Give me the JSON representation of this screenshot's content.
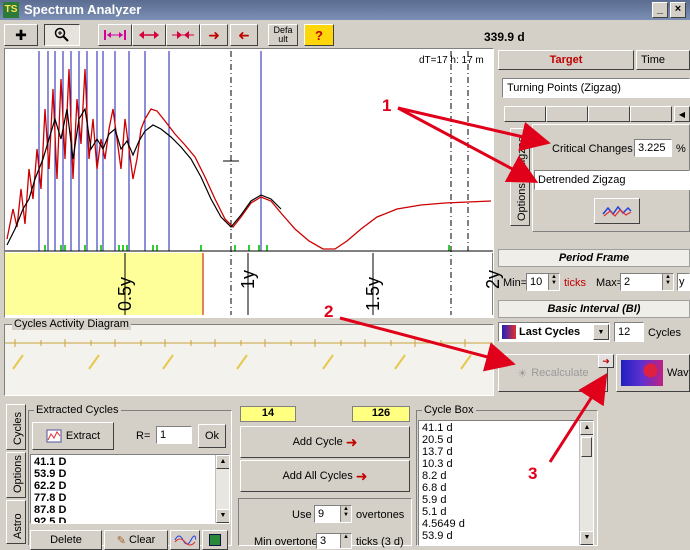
{
  "window": {
    "title": "Spectrum Analyzer",
    "icon": "TS"
  },
  "toolbar": {
    "default_label": "Defa ult",
    "help_label": "?",
    "timespan": "339.9 d"
  },
  "chart": {
    "readout": "dT=17 h: 17 m",
    "timeline_labels": [
      "0.5y",
      "1y",
      "1.5y",
      "2y"
    ],
    "activity_title": "Cycles Activity Diagram",
    "colors": {
      "black_line": "#000000",
      "red_line": "#cc0000",
      "marker": "#1c1cb0",
      "accent": "#c00000"
    }
  },
  "panel": {
    "tab_target": "Target",
    "tab_time": "Time",
    "target_select": "Turning Points (Zigzag)",
    "vtab_zigzag": "Zigzag",
    "vtab_options": "Options",
    "critical_changes_label": "Critical Changes",
    "critical_changes_value": "3.225",
    "critical_changes_unit": "%",
    "detrended_select": "Detrended Zigzag",
    "period_frame_title": "Period Frame",
    "min_label": "Min=",
    "min_value": "10",
    "ticks_label": "ticks",
    "max_label": "Max=",
    "max_value": "2",
    "max_unit": "y",
    "basic_interval_title": "Basic Interval (BI)",
    "bi_mode": "Last Cycles",
    "bi_count": "12",
    "bi_unit": "Cycles",
    "recalculate_label": "Recalculate",
    "wave_label": "Wav"
  },
  "bottom": {
    "side_tabs": [
      "Cycles",
      "Options",
      "Astro"
    ],
    "extracted_title": "Extracted Cycles",
    "extract_label": "Extract",
    "r_label": "R=",
    "r_value": "1",
    "ok_label": "Ok",
    "extracted_list": [
      "41.1 D",
      "53.9 D",
      "62.2 D",
      "77.8 D",
      "87.8 D",
      "92.5 D"
    ],
    "delete_label": "Delete",
    "clear_label": "Clear",
    "count_left": "14",
    "count_right": "126",
    "add_cycle_label": "Add Cycle",
    "add_all_label": "Add All Cycles",
    "use_label": "Use",
    "use_value": "9",
    "overtones_label": "overtones",
    "min_overtone_label": "Min overtone",
    "min_overtone_value": "3",
    "min_overtone_suffix": "ticks (3 d)",
    "cycle_box_title": "Cycle Box",
    "cycle_box_list": [
      "41.1 d",
      "20.5 d",
      "13.7 d",
      "10.3 d",
      "8.2 d",
      "6.8 d",
      "5.9 d",
      "5.1 d",
      "4.5649 d",
      "53.9 d"
    ]
  },
  "annotations": {
    "one": "1",
    "two": "2",
    "three": "3"
  }
}
